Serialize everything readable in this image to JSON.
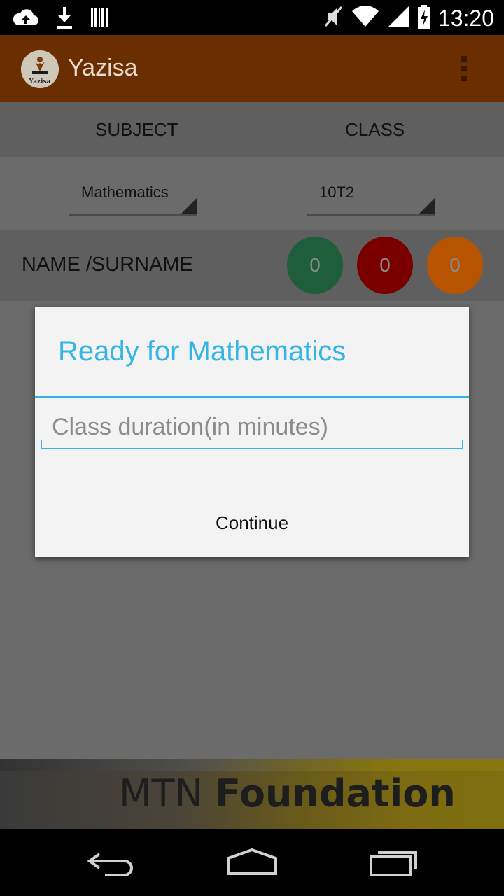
{
  "status_bar": {
    "time": "13:20",
    "left_icons": [
      "cloud-upload-icon",
      "download-icon",
      "barcode-icon"
    ],
    "right_icons": [
      "mute-icon",
      "wifi-icon",
      "signal-icon",
      "battery-charging-icon"
    ]
  },
  "app_bar": {
    "title": "Yazisa",
    "logo_text": "Yazisa",
    "overflow_icon": "more-vert-icon"
  },
  "tabs": {
    "subject_label": "SUBJECT",
    "class_label": "CLASS"
  },
  "selectors": {
    "subject_value": "Mathematics",
    "class_value": "10T2"
  },
  "header_row": {
    "name_label": "NAME /SURNAME",
    "counters": [
      {
        "value": "0",
        "color": "#1f5e3a"
      },
      {
        "value": "0",
        "color": "#7a0000"
      },
      {
        "value": "0",
        "color": "#b85400"
      }
    ]
  },
  "dialog": {
    "title": "Ready for Mathematics",
    "input_placeholder": "Class duration(in minutes)",
    "input_value": "",
    "continue_label": "Continue",
    "accent_color": "#33b5e5"
  },
  "banner": {
    "text_light": "MTN",
    "text_bold": "Foundation"
  },
  "nav_bar": {
    "icons": [
      "back-icon",
      "home-icon",
      "recents-icon"
    ]
  }
}
